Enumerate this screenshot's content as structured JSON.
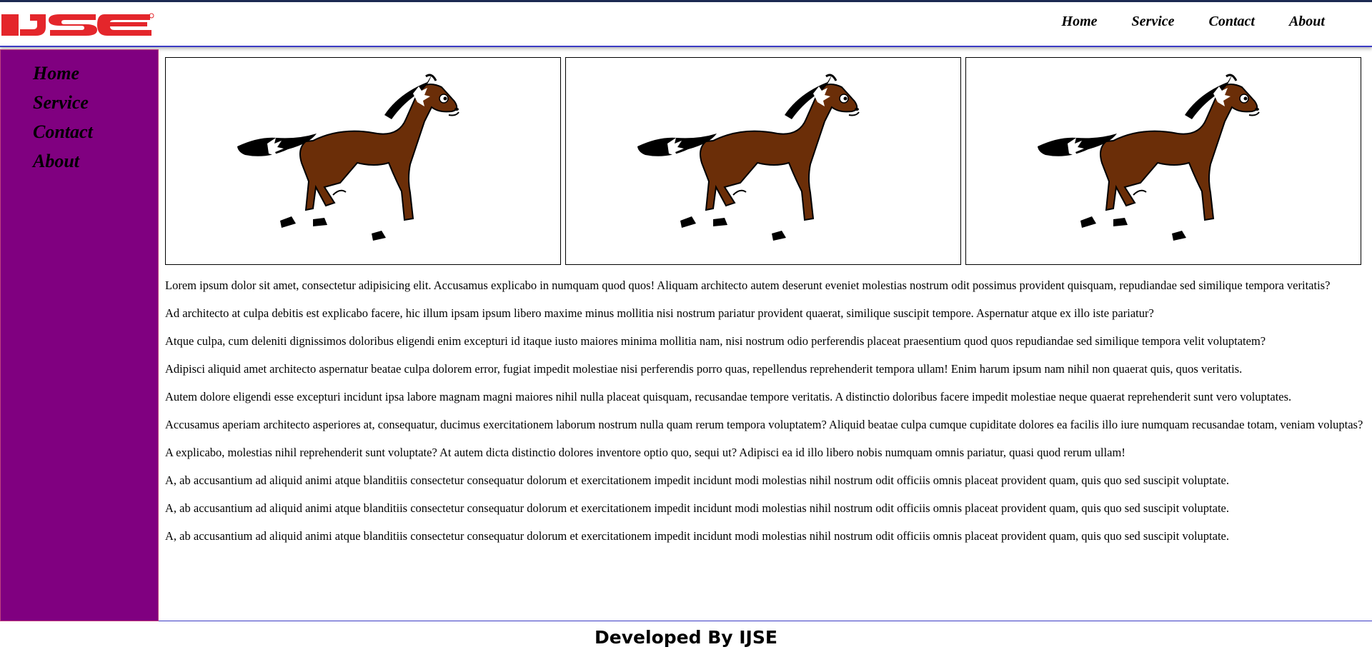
{
  "brand": {
    "logo_text": "IJSE",
    "logo_color": "#e4262b"
  },
  "topnav": {
    "items": [
      {
        "label": "Home"
      },
      {
        "label": "Service"
      },
      {
        "label": "Contact"
      },
      {
        "label": "About"
      }
    ]
  },
  "sidebar": {
    "background": "#800080",
    "items": [
      {
        "label": "Home"
      },
      {
        "label": "Service"
      },
      {
        "label": "Contact"
      },
      {
        "label": "About"
      }
    ]
  },
  "gallery": {
    "images": [
      {
        "icon": "cartoon-horse-image"
      },
      {
        "icon": "cartoon-horse-image"
      },
      {
        "icon": "cartoon-horse-image"
      }
    ]
  },
  "content": {
    "paragraphs": [
      "Lorem ipsum dolor sit amet, consectetur adipisicing elit. Accusamus explicabo in numquam quod quos! Aliquam architecto autem deserunt eveniet molestias nostrum odit possimus provident quisquam, repudiandae sed similique tempora veritatis?",
      "Ad architecto at culpa debitis est explicabo facere, hic illum ipsam ipsum libero maxime minus mollitia nisi nostrum pariatur provident quaerat, similique suscipit tempore. Aspernatur atque ex illo iste pariatur?",
      "Atque culpa, cum deleniti dignissimos doloribus eligendi enim excepturi id itaque iusto maiores minima mollitia nam, nisi nostrum odio perferendis placeat praesentium quod quos repudiandae sed similique tempora velit voluptatem?",
      "Adipisci aliquid amet architecto aspernatur beatae culpa dolorem error, fugiat impedit molestiae nisi perferendis porro quas, repellendus reprehenderit tempora ullam! Enim harum ipsum nam nihil non quaerat quis, quos veritatis.",
      "Autem dolore eligendi esse excepturi incidunt ipsa labore magnam magni maiores nihil nulla placeat quisquam, recusandae tempore veritatis. A distinctio doloribus facere impedit molestiae neque quaerat reprehenderit sunt vero voluptates.",
      "Accusamus aperiam architecto asperiores at, consequatur, ducimus exercitationem laborum nostrum nulla quam rerum tempora voluptatem? Aliquid beatae culpa cumque cupiditate dolores ea facilis illo iure numquam recusandae totam, veniam voluptas?",
      "A explicabo, molestias nihil reprehenderit sunt voluptate? At autem dicta distinctio dolores inventore optio quo, sequi ut? Adipisci ea id illo libero nobis numquam omnis pariatur, quasi quod rerum ullam!",
      "A, ab accusantium ad aliquid animi atque blanditiis consectetur consequatur dolorum et exercitationem impedit incidunt modi molestias nihil nostrum odit officiis omnis placeat provident quam, quis quo sed suscipit voluptate.",
      "A, ab accusantium ad aliquid animi atque blanditiis consectetur consequatur dolorum et exercitationem impedit incidunt modi molestias nihil nostrum odit officiis omnis placeat provident quam, quis quo sed suscipit voluptate.",
      "A, ab accusantium ad aliquid animi atque blanditiis consectetur consequatur dolorum et exercitationem impedit incidunt modi molestias nihil nostrum odit officiis omnis placeat provident quam, quis quo sed suscipit voluptate."
    ]
  },
  "footer": {
    "text": "Developed By IJSE"
  }
}
